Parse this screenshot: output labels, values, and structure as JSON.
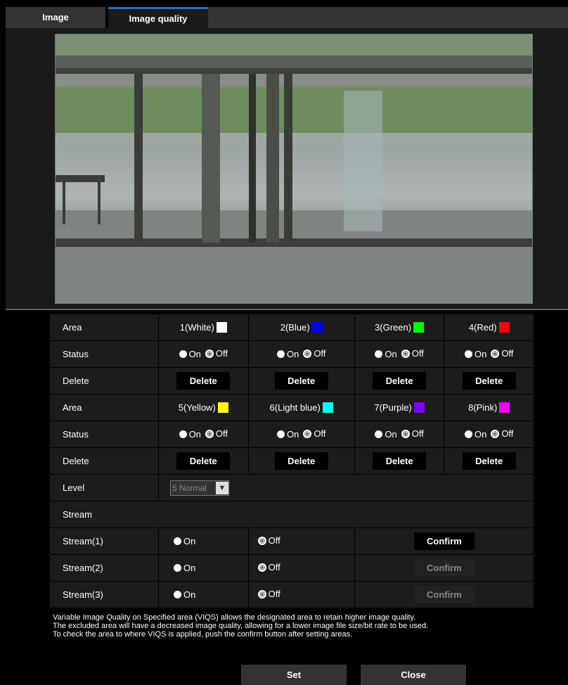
{
  "tabs": [
    {
      "label": "Image"
    },
    {
      "label": "Image quality"
    }
  ],
  "areas_top": [
    {
      "label": "1(White)",
      "color": "#ffffff"
    },
    {
      "label": "2(Blue)",
      "color": "#0000ff"
    },
    {
      "label": "3(Green)",
      "color": "#00ff00"
    },
    {
      "label": "4(Red)",
      "color": "#ff0000"
    }
  ],
  "areas_bottom": [
    {
      "label": "5(Yellow)",
      "color": "#ffff00"
    },
    {
      "label": "6(Light blue)",
      "color": "#00ffff"
    },
    {
      "label": "7(Purple)",
      "color": "#8000ff"
    },
    {
      "label": "8(Pink)",
      "color": "#ff00ff"
    }
  ],
  "row_labels": {
    "area": "Area",
    "status": "Status",
    "delete": "Delete",
    "level": "Level",
    "stream": "Stream",
    "stream1": "Stream(1)",
    "stream2": "Stream(2)",
    "stream3": "Stream(3)"
  },
  "radio": {
    "on": "On",
    "off": "Off"
  },
  "delete_label": "Delete",
  "level_value": "5 Normal",
  "confirm_label": "Confirm",
  "note": [
    "Variable Image Quality on Specified area (VIQS) allows the designated area to retain higher image quality.",
    "The excluded area will have a decreased image quality, allowing for a lower image file size/bit rate to be used.",
    "To check the area to where VIQS is applied, push the confirm button after setting areas."
  ],
  "buttons": {
    "set": "Set",
    "close": "Close"
  }
}
